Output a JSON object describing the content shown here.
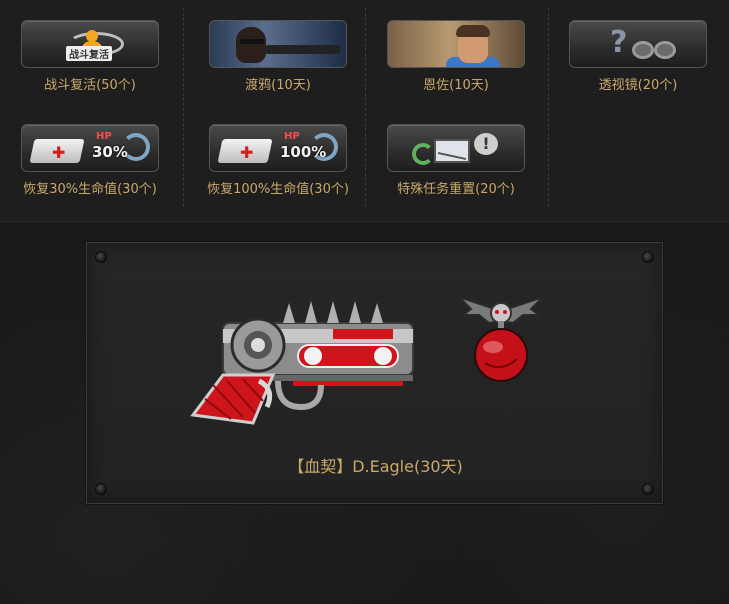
{
  "rewards": [
    {
      "id": "revive",
      "label": "战斗复活(50个)",
      "icon": "revive-icon",
      "badge_text": "战斗复活"
    },
    {
      "id": "raven",
      "label": "渡鸦(10天)",
      "icon": "raven-character-portrait"
    },
    {
      "id": "enzo",
      "label": "恩佐(10天)",
      "icon": "enzo-character-portrait"
    },
    {
      "id": "xray",
      "label": "透视镜(20个)",
      "icon": "binoculars-icon"
    },
    {
      "id": "heal30",
      "label": "恢复30%生命值(30个)",
      "icon": "medkit-icon",
      "hp_label": "HP",
      "hp_value": "30%"
    },
    {
      "id": "heal100",
      "label": "恢复100%生命值(30个)",
      "icon": "medkit-icon",
      "hp_label": "HP",
      "hp_value": "100%"
    },
    {
      "id": "mission_reset",
      "label": "特殊任务重置(20个)",
      "icon": "mission-reset-icon",
      "bubble": "!"
    }
  ],
  "featured": {
    "name": "【血契】D.Eagle(30天)",
    "weapon_icon": "desert-eagle-blood-pact-pistol",
    "charm_icon": "bat-orb-charm"
  },
  "colors": {
    "label_gold": "#c9a86a",
    "background": "#191919",
    "panel": "#242424",
    "accent_red": "#d81c1c"
  }
}
